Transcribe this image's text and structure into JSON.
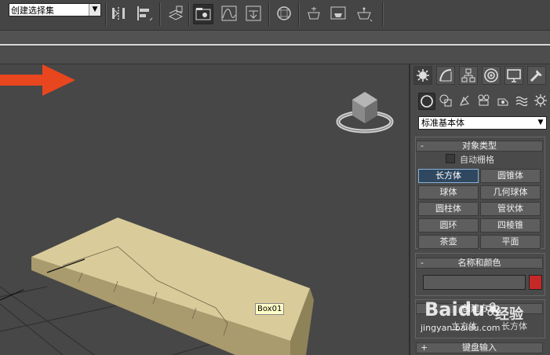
{
  "toolbar": {
    "selection_set": {
      "value": "创建选择集",
      "arrow": "▼"
    },
    "icons": [
      "mirror-icon",
      "align-icon",
      "layer-manager-icon",
      "scene-explorer-icon",
      "curve-editor-icon",
      "schematic-view-icon",
      "material-editor-icon",
      "render-setup-icon",
      "rendered-frame-icon",
      "render-icon"
    ]
  },
  "viewport": {
    "object_label": "Box01",
    "arrow_color": "#e8461e",
    "box_top_color": "#d9cc9a",
    "box_front_color": "#a99b6d"
  },
  "command_panel": {
    "tabs": [
      "create-tab-icon",
      "modify-tab-icon",
      "hierarchy-tab-icon",
      "motion-tab-icon",
      "display-tab-icon",
      "utilities-tab-icon"
    ],
    "categories": [
      "geometry-icon",
      "shapes-icon",
      "lights-icon",
      "cameras-icon",
      "helpers-icon",
      "space-warps-icon",
      "systems-icon"
    ],
    "dropdown": {
      "value": "标准基本体",
      "arrow": "▼"
    },
    "object_type": {
      "sign": "-",
      "title": "对象类型",
      "autogrid": "自动栅格",
      "buttons": [
        "长方体",
        "圆锥体",
        "球体",
        "几何球体",
        "圆柱体",
        "管状体",
        "圆环",
        "四棱锥",
        "茶壶",
        "平面"
      ],
      "active_index": 0
    },
    "name_color": {
      "sign": "-",
      "title": "名称和颜色",
      "swatch": "#c62828"
    },
    "creation_method": {
      "title": "创建方法",
      "options": [
        "立方体",
        "长方体"
      ]
    },
    "keyboard_entry": {
      "sign": "+",
      "title": "键盘输入"
    }
  },
  "watermark": {
    "logo": "Baidu",
    "paw": "❀",
    "jingyan": "经验",
    "url": "jingyan.baidu.com"
  }
}
